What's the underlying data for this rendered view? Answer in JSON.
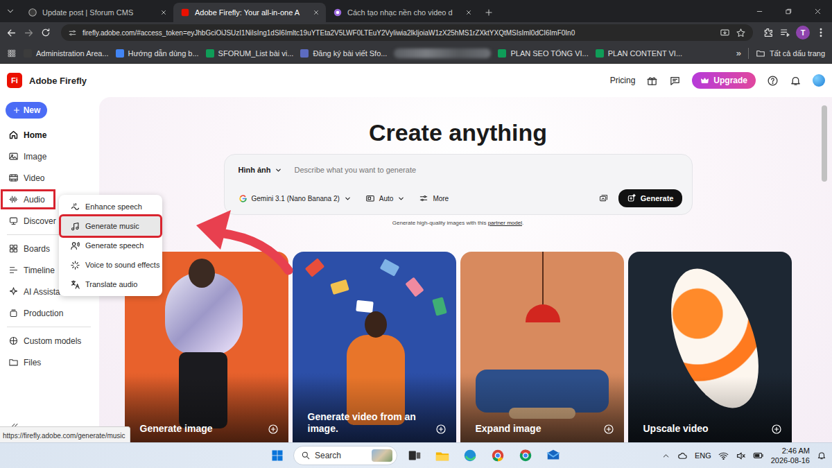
{
  "browser": {
    "tabs": [
      {
        "label": "Update post | Sforum CMS",
        "selected": false
      },
      {
        "label": "Adobe Firefly: Your all-in-one A",
        "selected": true
      },
      {
        "label": "Cách tạo nhạc nền cho video d",
        "selected": false
      }
    ],
    "address": "firefly.adobe.com/#access_token=eyJhbGciOiJSUzI1NiIsIng1dSI6Imltc19uYTEta2V5LWF0LTEuY2VyIiwia2lkIjoiaW1zX25hMS1rZXktYXQtMSIsIml0dCI6ImF0In0",
    "profile_initial": "T",
    "bookmarks": [
      {
        "label": "Administration Area...",
        "color": "#3c3c3c"
      },
      {
        "label": "Hướng dẫn dùng b...",
        "color": "#4285f4"
      },
      {
        "label": "SFORUM_List bài vi...",
        "color": "#0f9d58"
      },
      {
        "label": "Đăng ký bài viết Sfo...",
        "color": "#5c6bc0"
      },
      {
        "label": "PLAN SEO TỔNG VI...",
        "color": "#0f9d58"
      },
      {
        "label": "PLAN CONTENT VI...",
        "color": "#0f9d58"
      }
    ],
    "bookmarks_overflow": "»",
    "all_bookmarks": "Tất cả dấu trang",
    "status_url": "https://firefly.adobe.com/generate/music"
  },
  "header": {
    "logo": "Fi",
    "title": "Adobe Firefly",
    "pricing": "Pricing",
    "upgrade": "Upgrade"
  },
  "sidebar": {
    "new_button": "New",
    "sections": [
      {
        "items": [
          {
            "label": "Home",
            "selected": true,
            "highlighted": false
          },
          {
            "label": "Image",
            "selected": false,
            "highlighted": false
          },
          {
            "label": "Video",
            "selected": false,
            "highlighted": false
          },
          {
            "label": "Audio",
            "selected": false,
            "highlighted": true
          },
          {
            "label": "Discover",
            "selected": false,
            "highlighted": false
          }
        ]
      },
      {
        "items": [
          {
            "label": "Boards",
            "selected": false,
            "highlighted": false
          },
          {
            "label": "Timeline",
            "selected": false,
            "highlighted": false
          },
          {
            "label": "AI Assistant",
            "selected": false,
            "highlighted": false
          },
          {
            "label": "Production",
            "selected": false,
            "highlighted": false
          }
        ]
      },
      {
        "items": [
          {
            "label": "Custom models",
            "selected": false,
            "highlighted": false
          },
          {
            "label": "Files",
            "selected": false,
            "highlighted": false
          }
        ]
      }
    ]
  },
  "audio_menu": {
    "items": [
      {
        "label": "Enhance speech",
        "selected": false,
        "highlighted": false
      },
      {
        "label": "Generate music",
        "selected": true,
        "highlighted": true
      },
      {
        "label": "Generate speech",
        "selected": false,
        "highlighted": false
      },
      {
        "label": "Voice to sound effects",
        "selected": false,
        "highlighted": false
      },
      {
        "label": "Translate audio",
        "selected": false,
        "highlighted": false
      }
    ]
  },
  "main": {
    "title": "Create anything",
    "prompt": {
      "mode": "Hình ảnh",
      "placeholder": "Describe what you want to generate",
      "model": "Gemini 3.1 (Nano Banana 2)",
      "aspect": "Auto",
      "more": "More",
      "generate": "Generate"
    },
    "caption": {
      "text": "Generate high-quality images with this ",
      "link": "partner model",
      "end": "."
    }
  },
  "cards": [
    {
      "label": "Generate image",
      "color": "#e8612c"
    },
    {
      "label": "Generate video from an image.",
      "color": "#2c4fa8"
    },
    {
      "label": "Expand image",
      "color": "#d88a5e"
    },
    {
      "label": "Upscale video",
      "color": "#1d2733"
    }
  ],
  "taskbar": {
    "search": "Search",
    "language": "ENG",
    "time": "2:46 AM",
    "date": "2026-08-16"
  }
}
